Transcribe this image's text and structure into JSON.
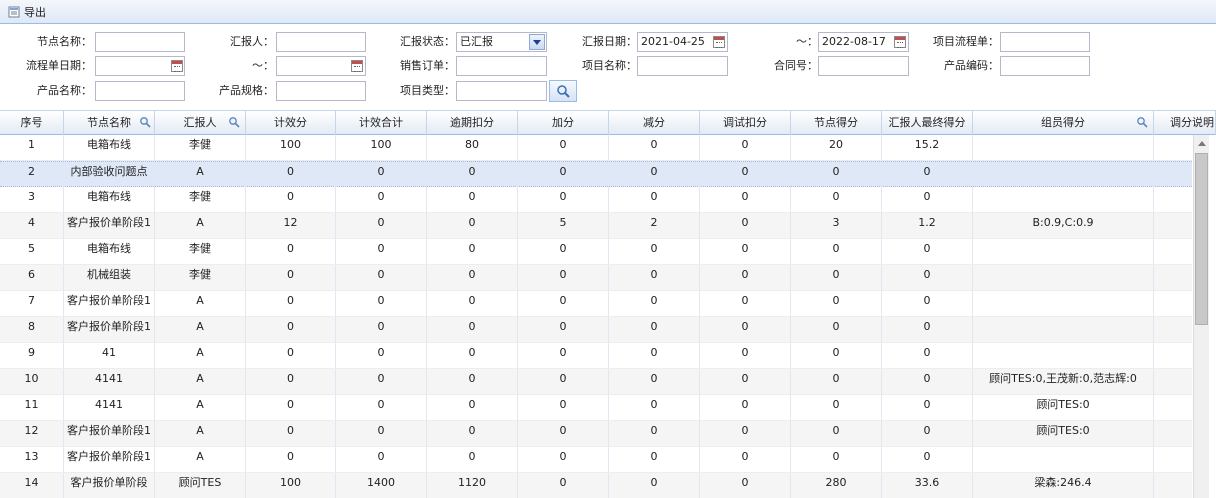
{
  "toolbar": {
    "export_label": "导出"
  },
  "filters": {
    "node_name_label": "节点名称：",
    "reporter_label": "汇报人：",
    "report_status_label": "汇报状态：",
    "report_status_value": "已汇报",
    "report_date_label": "汇报日期：",
    "report_date_from": "2021-04-25",
    "range_sep": "～：",
    "report_date_to": "2022-08-17",
    "project_flow_label": "项目流程单：",
    "flow_date_label": "流程单日期：",
    "flow_range_sep": "～：",
    "sales_order_label": "销售订单：",
    "project_name_label": "项目名称：",
    "contract_no_label": "合同号：",
    "product_code_label": "产品编码：",
    "product_name_label": "产品名称：",
    "product_spec_label": "产品规格：",
    "project_type_label": "项目类型："
  },
  "table": {
    "columns": [
      "序号",
      "节点名称",
      "汇报人",
      "计效分",
      "计效合计",
      "逾期扣分",
      "加分",
      "减分",
      "调试扣分",
      "节点得分",
      "汇报人最终得分",
      "组员得分",
      "调分说明"
    ],
    "rows": [
      [
        "1",
        "电箱布线",
        "李健",
        "100",
        "100",
        "80",
        "0",
        "0",
        "0",
        "20",
        "15.2",
        "",
        ""
      ],
      [
        "2",
        "内部验收问题点",
        "A",
        "0",
        "0",
        "0",
        "0",
        "0",
        "0",
        "0",
        "0",
        "",
        ""
      ],
      [
        "3",
        "电箱布线",
        "李健",
        "0",
        "0",
        "0",
        "0",
        "0",
        "0",
        "0",
        "0",
        "",
        ""
      ],
      [
        "4",
        "客户报价单阶段1",
        "A",
        "12",
        "0",
        "0",
        "5",
        "2",
        "0",
        "3",
        "1.2",
        "B:0.9,C:0.9",
        ""
      ],
      [
        "5",
        "电箱布线",
        "李健",
        "0",
        "0",
        "0",
        "0",
        "0",
        "0",
        "0",
        "0",
        "",
        ""
      ],
      [
        "6",
        "机械组装",
        "李健",
        "0",
        "0",
        "0",
        "0",
        "0",
        "0",
        "0",
        "0",
        "",
        ""
      ],
      [
        "7",
        "客户报价单阶段1",
        "A",
        "0",
        "0",
        "0",
        "0",
        "0",
        "0",
        "0",
        "0",
        "",
        ""
      ],
      [
        "8",
        "客户报价单阶段1",
        "A",
        "0",
        "0",
        "0",
        "0",
        "0",
        "0",
        "0",
        "0",
        "",
        ""
      ],
      [
        "9",
        "41",
        "A",
        "0",
        "0",
        "0",
        "0",
        "0",
        "0",
        "0",
        "0",
        "",
        ""
      ],
      [
        "10",
        "4141",
        "A",
        "0",
        "0",
        "0",
        "0",
        "0",
        "0",
        "0",
        "0",
        "顾问TES:0,王茂新:0,范志辉:0",
        ""
      ],
      [
        "11",
        "4141",
        "A",
        "0",
        "0",
        "0",
        "0",
        "0",
        "0",
        "0",
        "0",
        "顾问TES:0",
        ""
      ],
      [
        "12",
        "客户报价单阶段1",
        "A",
        "0",
        "0",
        "0",
        "0",
        "0",
        "0",
        "0",
        "0",
        "顾问TES:0",
        ""
      ],
      [
        "13",
        "客户报价单阶段1",
        "A",
        "0",
        "0",
        "0",
        "0",
        "0",
        "0",
        "0",
        "0",
        "",
        ""
      ],
      [
        "14",
        "客户报价单阶段",
        "顾问TES",
        "100",
        "1400",
        "1120",
        "0",
        "0",
        "0",
        "280",
        "33.6",
        "梁森:246.4",
        ""
      ]
    ]
  },
  "icons": {
    "export": "export-icon",
    "calendar": "calendar-icon",
    "search": "search-icon",
    "dropdown": "chevron-down-icon"
  },
  "colors": {
    "header_bg": "#dfe8f6",
    "border": "#99bbe8",
    "selected_row": "#dfe8f6",
    "alt_row": "#f5f5f5"
  }
}
